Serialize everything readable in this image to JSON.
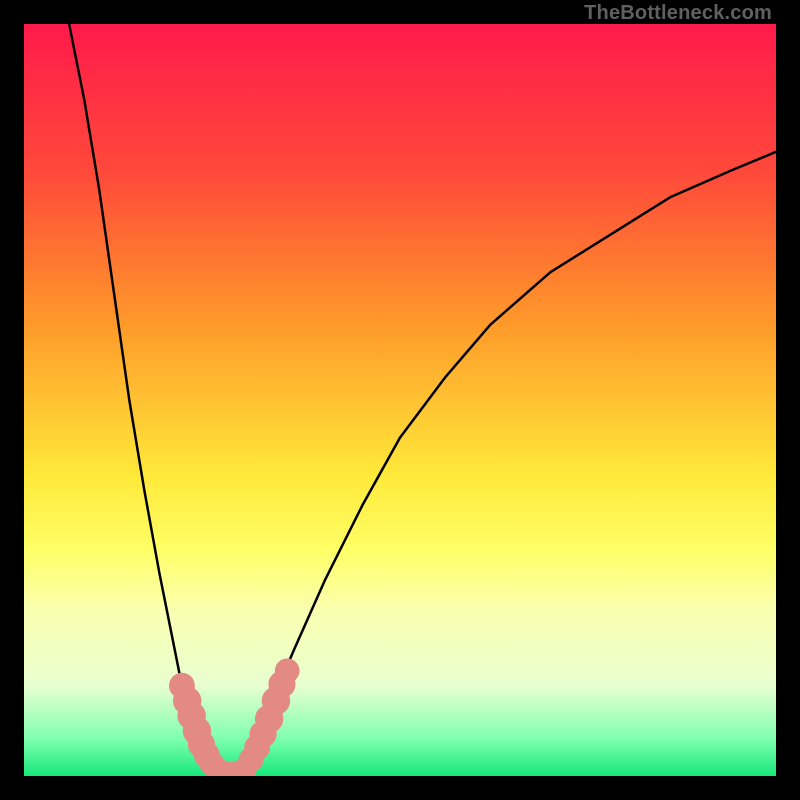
{
  "watermark": "TheBottleneck.com",
  "chart_data": {
    "type": "line",
    "title": "",
    "xlabel": "",
    "ylabel": "",
    "xlim": [
      0,
      100
    ],
    "ylim": [
      0,
      100
    ],
    "gradient_stops": [
      {
        "offset": 0.0,
        "color": "#ff1a4b"
      },
      {
        "offset": 0.2,
        "color": "#ff4a3a"
      },
      {
        "offset": 0.4,
        "color": "#ff9a2a"
      },
      {
        "offset": 0.6,
        "color": "#ffe93a"
      },
      {
        "offset": 0.7,
        "color": "#ffff66"
      },
      {
        "offset": 0.78,
        "color": "#faffb0"
      },
      {
        "offset": 0.88,
        "color": "#e8ffd0"
      },
      {
        "offset": 0.95,
        "color": "#7fffb0"
      },
      {
        "offset": 1.0,
        "color": "#17e87a"
      }
    ],
    "series": [
      {
        "name": "left-curve",
        "stroke": "#000000",
        "x": [
          6,
          8,
          10,
          12,
          14,
          16,
          18,
          20,
          21,
          22,
          23,
          24,
          25,
          26,
          27
        ],
        "y": [
          100,
          90,
          78,
          64,
          50,
          38,
          27,
          17,
          12,
          8,
          5,
          3,
          1.5,
          0.7,
          0.2
        ]
      },
      {
        "name": "right-curve",
        "stroke": "#000000",
        "x": [
          27,
          28,
          30,
          33,
          36,
          40,
          45,
          50,
          56,
          62,
          70,
          78,
          86,
          94,
          100
        ],
        "y": [
          0.2,
          1,
          4,
          10,
          17,
          26,
          36,
          45,
          53,
          60,
          67,
          72,
          77,
          80.5,
          83
        ]
      }
    ],
    "markers": {
      "name": "salmon-dots",
      "color": "#e48a84",
      "points": [
        {
          "x": 21.0,
          "y": 12.0,
          "r": 1.4
        },
        {
          "x": 21.7,
          "y": 10.0,
          "r": 1.6
        },
        {
          "x": 22.3,
          "y": 8.0,
          "r": 1.6
        },
        {
          "x": 23.0,
          "y": 6.0,
          "r": 1.6
        },
        {
          "x": 23.6,
          "y": 4.2,
          "r": 1.5
        },
        {
          "x": 24.3,
          "y": 2.8,
          "r": 1.4
        },
        {
          "x": 25.0,
          "y": 1.6,
          "r": 1.3
        },
        {
          "x": 25.7,
          "y": 0.9,
          "r": 1.2
        },
        {
          "x": 26.4,
          "y": 0.4,
          "r": 1.3
        },
        {
          "x": 27.0,
          "y": 0.15,
          "r": 1.4
        },
        {
          "x": 27.8,
          "y": 0.15,
          "r": 1.4
        },
        {
          "x": 28.6,
          "y": 0.4,
          "r": 1.3
        },
        {
          "x": 29.4,
          "y": 1.0,
          "r": 1.2
        },
        {
          "x": 30.2,
          "y": 2.2,
          "r": 1.3
        },
        {
          "x": 31.0,
          "y": 3.8,
          "r": 1.4
        },
        {
          "x": 31.8,
          "y": 5.6,
          "r": 1.5
        },
        {
          "x": 32.6,
          "y": 7.6,
          "r": 1.6
        },
        {
          "x": 33.5,
          "y": 10.0,
          "r": 1.6
        },
        {
          "x": 34.3,
          "y": 12.2,
          "r": 1.5
        },
        {
          "x": 35.0,
          "y": 14.0,
          "r": 1.3
        }
      ]
    }
  }
}
